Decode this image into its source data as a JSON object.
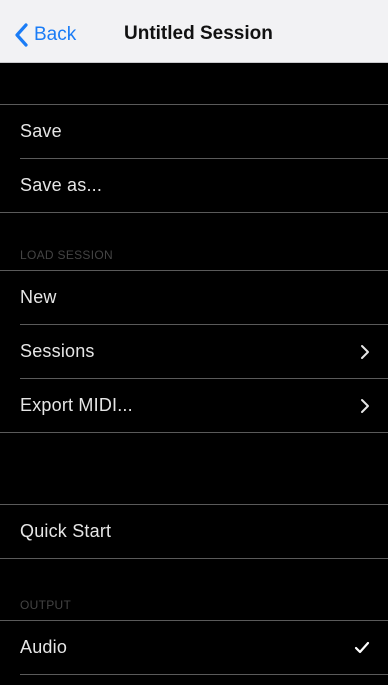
{
  "nav": {
    "back_label": "Back",
    "title": "Untitled Session"
  },
  "rows": {
    "save": "Save",
    "save_as": "Save as...",
    "new": "New",
    "sessions": "Sessions",
    "export_midi": "Export MIDI...",
    "quick_start": "Quick Start",
    "audio": "Audio"
  },
  "sections": {
    "load_session": "LOAD SESSION",
    "output": "OUTPUT"
  },
  "colors": {
    "accent": "#1a7cf6",
    "background": "#000000",
    "navbar": "#f2f2f4",
    "separator": "#5a5a5a"
  },
  "icons": {
    "back": "chevron-left-icon",
    "disclosure": "chevron-right-icon",
    "selected": "checkmark-icon"
  },
  "state": {
    "audio_selected": true
  }
}
